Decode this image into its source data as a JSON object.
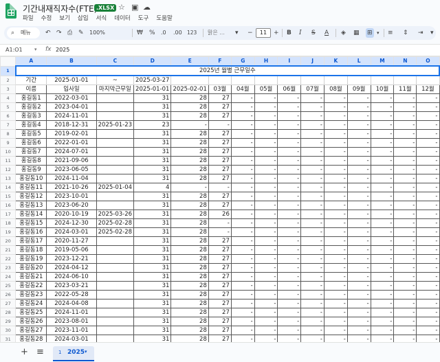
{
  "app": {
    "title": "기간내재직자수(FTE)",
    "badge": ".XLSX",
    "star_icon": "star-icon",
    "move_icon": "folder-icon",
    "cloud_icon": "cloud-icon"
  },
  "menus": [
    "파일",
    "수정",
    "보기",
    "삽입",
    "서식",
    "데이터",
    "도구",
    "도움말"
  ],
  "toolbar": {
    "search": "메뉴",
    "zoom": "100%",
    "currency": "₩",
    "percent": "%",
    "dec_dec": ".0",
    "dec_inc": ".00",
    "numfmt": "123",
    "font": "맑은 ...",
    "font_size": "11",
    "bold": "B",
    "italic": "I",
    "strike": "S",
    "textcolor": "A"
  },
  "formula": {
    "cell": "A1:O1",
    "fx": "fx",
    "value": "2025"
  },
  "columns": [
    "A",
    "B",
    "C",
    "D",
    "E",
    "F",
    "G",
    "H",
    "I",
    "J",
    "K",
    "L",
    "M",
    "N",
    "O"
  ],
  "sheet": {
    "title": "2025년 월별 근무일수",
    "row2": {
      "label": "기간",
      "from": "2025-01-01",
      "tilde": "~",
      "to": "2025-03-27"
    },
    "headers": [
      "이름",
      "입사일",
      "마지막근무일",
      "2025-01-01",
      "2025-02-01",
      "03월",
      "04월",
      "05월",
      "06월",
      "07월",
      "08월",
      "09월",
      "10월",
      "11월",
      "12월"
    ],
    "rows": [
      [
        "홍길동1",
        "2022-03-01",
        "",
        "31",
        "28",
        "27"
      ],
      [
        "홍길동2",
        "2023-04-01",
        "",
        "31",
        "28",
        "27"
      ],
      [
        "홍길동3",
        "2024-11-01",
        "",
        "31",
        "28",
        "27"
      ],
      [
        "홍길동4",
        "2018-12-31",
        "2025-01-23",
        "23",
        "-",
        "-"
      ],
      [
        "홍길동5",
        "2019-02-01",
        "",
        "31",
        "28",
        "27"
      ],
      [
        "홍길동6",
        "2022-01-01",
        "",
        "31",
        "28",
        "27"
      ],
      [
        "홍길동7",
        "2024-07-01",
        "",
        "31",
        "28",
        "27"
      ],
      [
        "홍길동8",
        "2021-09-06",
        "",
        "31",
        "28",
        "27"
      ],
      [
        "홍길동9",
        "2023-06-05",
        "",
        "31",
        "28",
        "27"
      ],
      [
        "홍길동10",
        "2024-11-04",
        "",
        "31",
        "28",
        "27"
      ],
      [
        "홍길동11",
        "2021-10-26",
        "2025-01-04",
        "4",
        "-",
        "-"
      ],
      [
        "홍길동12",
        "2023-10-01",
        "",
        "31",
        "28",
        "27"
      ],
      [
        "홍길동13",
        "2023-06-20",
        "",
        "31",
        "28",
        "27"
      ],
      [
        "홍길동14",
        "2020-10-19",
        "2025-03-26",
        "31",
        "28",
        "26"
      ],
      [
        "홍길동15",
        "2024-12-30",
        "2025-02-28",
        "31",
        "28",
        "-"
      ],
      [
        "홍길동16",
        "2024-03-01",
        "2025-02-28",
        "31",
        "28",
        "-"
      ],
      [
        "홍길동17",
        "2020-11-27",
        "",
        "31",
        "28",
        "27"
      ],
      [
        "홍길동18",
        "2019-05-06",
        "",
        "31",
        "28",
        "27"
      ],
      [
        "홍길동19",
        "2023-12-21",
        "",
        "31",
        "28",
        "27"
      ],
      [
        "홍길동20",
        "2024-04-12",
        "",
        "31",
        "28",
        "27"
      ],
      [
        "홍길동21",
        "2024-06-10",
        "",
        "31",
        "28",
        "27"
      ],
      [
        "홍길동22",
        "2023-03-21",
        "",
        "31",
        "28",
        "27"
      ],
      [
        "홍길동23",
        "2022-05-28",
        "",
        "31",
        "28",
        "27"
      ],
      [
        "홍길동24",
        "2024-04-08",
        "",
        "31",
        "28",
        "27"
      ],
      [
        "홍길동25",
        "2024-11-01",
        "",
        "31",
        "28",
        "27"
      ],
      [
        "홍길동26",
        "2023-08-01",
        "",
        "31",
        "28",
        "27"
      ],
      [
        "홍길동27",
        "2023-11-01",
        "",
        "31",
        "28",
        "27"
      ],
      [
        "홍길동28",
        "2024-03-01",
        "",
        "31",
        "28",
        "27"
      ],
      [
        "홍길동29",
        "2024-03-18",
        "",
        "31",
        "28",
        "27"
      ]
    ],
    "empty_month": "-"
  },
  "bottom": {
    "add": "+",
    "list": "≡",
    "sheet_num": "1",
    "sheet_name": "2025",
    "sheet_dd": "▾"
  },
  "colors": {
    "accent": "#0b57d0",
    "green": "#188038"
  }
}
